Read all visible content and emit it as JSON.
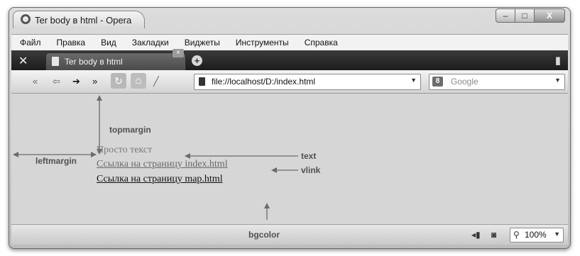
{
  "window": {
    "title": "Ter body в html - Opera",
    "minimize": "–",
    "maximize": "□",
    "close": "X"
  },
  "menu": [
    "Файл",
    "Правка",
    "Вид",
    "Закладки",
    "Виджеты",
    "Инструменты",
    "Справка"
  ],
  "tabs": {
    "active_label": "Ter body в html",
    "close_glyph": "×",
    "new_tab_glyph": "+"
  },
  "navigation": {
    "address": "file://localhost/D:/index.html",
    "search_placeholder": "Google",
    "search_logo": "8"
  },
  "page": {
    "plain_text": "Просто текст",
    "link_visited": "Ссылка на страницу index.html",
    "link_unvisited": "Ссылка на страницу map.html"
  },
  "annotations": {
    "topmargin": "topmargin",
    "leftmargin": "leftmargin",
    "text": "text",
    "vlink": "vlink",
    "bgcolor": "bgcolor"
  },
  "status": {
    "zoom": "100%"
  }
}
